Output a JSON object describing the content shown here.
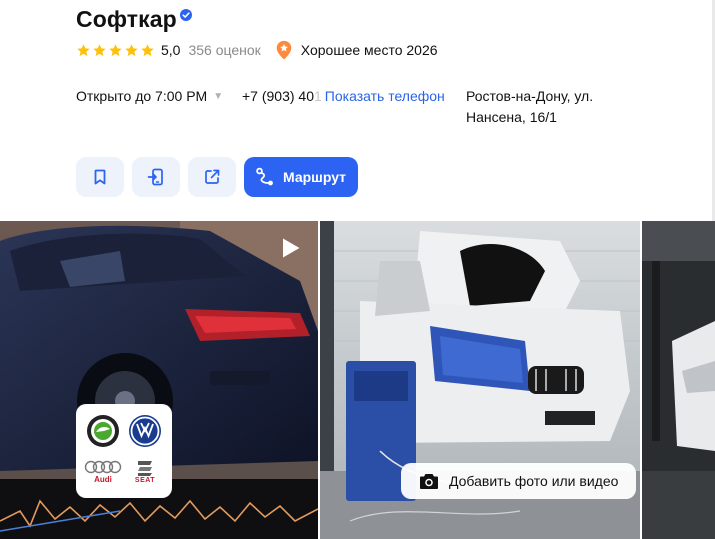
{
  "business": {
    "name": "Софткар",
    "rating": "5,0",
    "reviews": "356 оценок",
    "award": "Хорошее место 2026"
  },
  "info": {
    "hours": "Открыто до 7:00 PM",
    "phone_visible": "+7 (903) 40",
    "phone_faded": "1",
    "show_phone": "Показать телефон",
    "address": "Ростов-на-Дону, ул. Нансена, 16/1"
  },
  "actions": {
    "route_label": "Маршрут"
  },
  "photos": {
    "add_media_label": "Добавить фото или видео"
  },
  "brands": {
    "audi": "Audi",
    "seat": "SEAT"
  },
  "colors": {
    "accent": "#2c63f3",
    "link": "#2a63e6",
    "star": "#ffc107",
    "action_bg": "#eef2fb"
  },
  "icons": [
    "verified-icon",
    "star-icon",
    "award-icon",
    "bookmark-icon",
    "send-to-phone-icon",
    "share-icon",
    "route-icon",
    "play-icon",
    "camera-icon"
  ]
}
